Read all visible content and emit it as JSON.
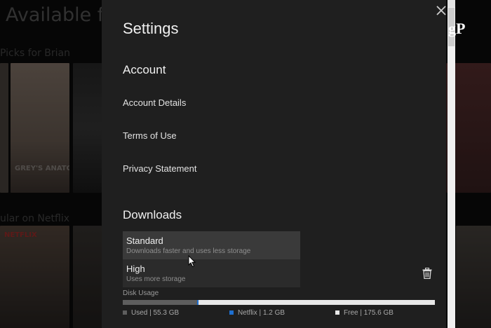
{
  "background": {
    "heading": "Available fo",
    "row1_label": "Picks for Brian",
    "row2_label": "ular on Netflix",
    "posters": [
      {
        "text": "GREY'S ANATOMY",
        "color": "#7a6a5c"
      },
      {
        "text": "NETFLIX",
        "color": "#8a2a2a"
      }
    ]
  },
  "settings": {
    "title": "Settings",
    "account": {
      "heading": "Account",
      "items": [
        "Account Details",
        "Terms of Use",
        "Privacy Statement"
      ]
    },
    "downloads": {
      "heading": "Downloads",
      "options": [
        {
          "title": "Standard",
          "subtitle": "Downloads faster and uses less storage",
          "selected": true
        },
        {
          "title": "High",
          "subtitle": "Uses more storage",
          "selected": false
        }
      ],
      "disk_usage": {
        "label": "Disk Usage",
        "used": {
          "label": "Used | 55.3 GB",
          "gb": 55.3,
          "color": "#5e5e5e"
        },
        "netflix": {
          "label": "Netflix | 1.2 GB",
          "gb": 1.2,
          "color": "#1e6fd0"
        },
        "free": {
          "label": "Free | 175.6 GB",
          "gb": 175.6,
          "color": "#e8e8e8"
        }
      },
      "trash_icon": "trash-icon"
    }
  },
  "watermark": "gP",
  "icons": {
    "close": "close-icon",
    "cursor": "mouse-cursor-icon"
  }
}
